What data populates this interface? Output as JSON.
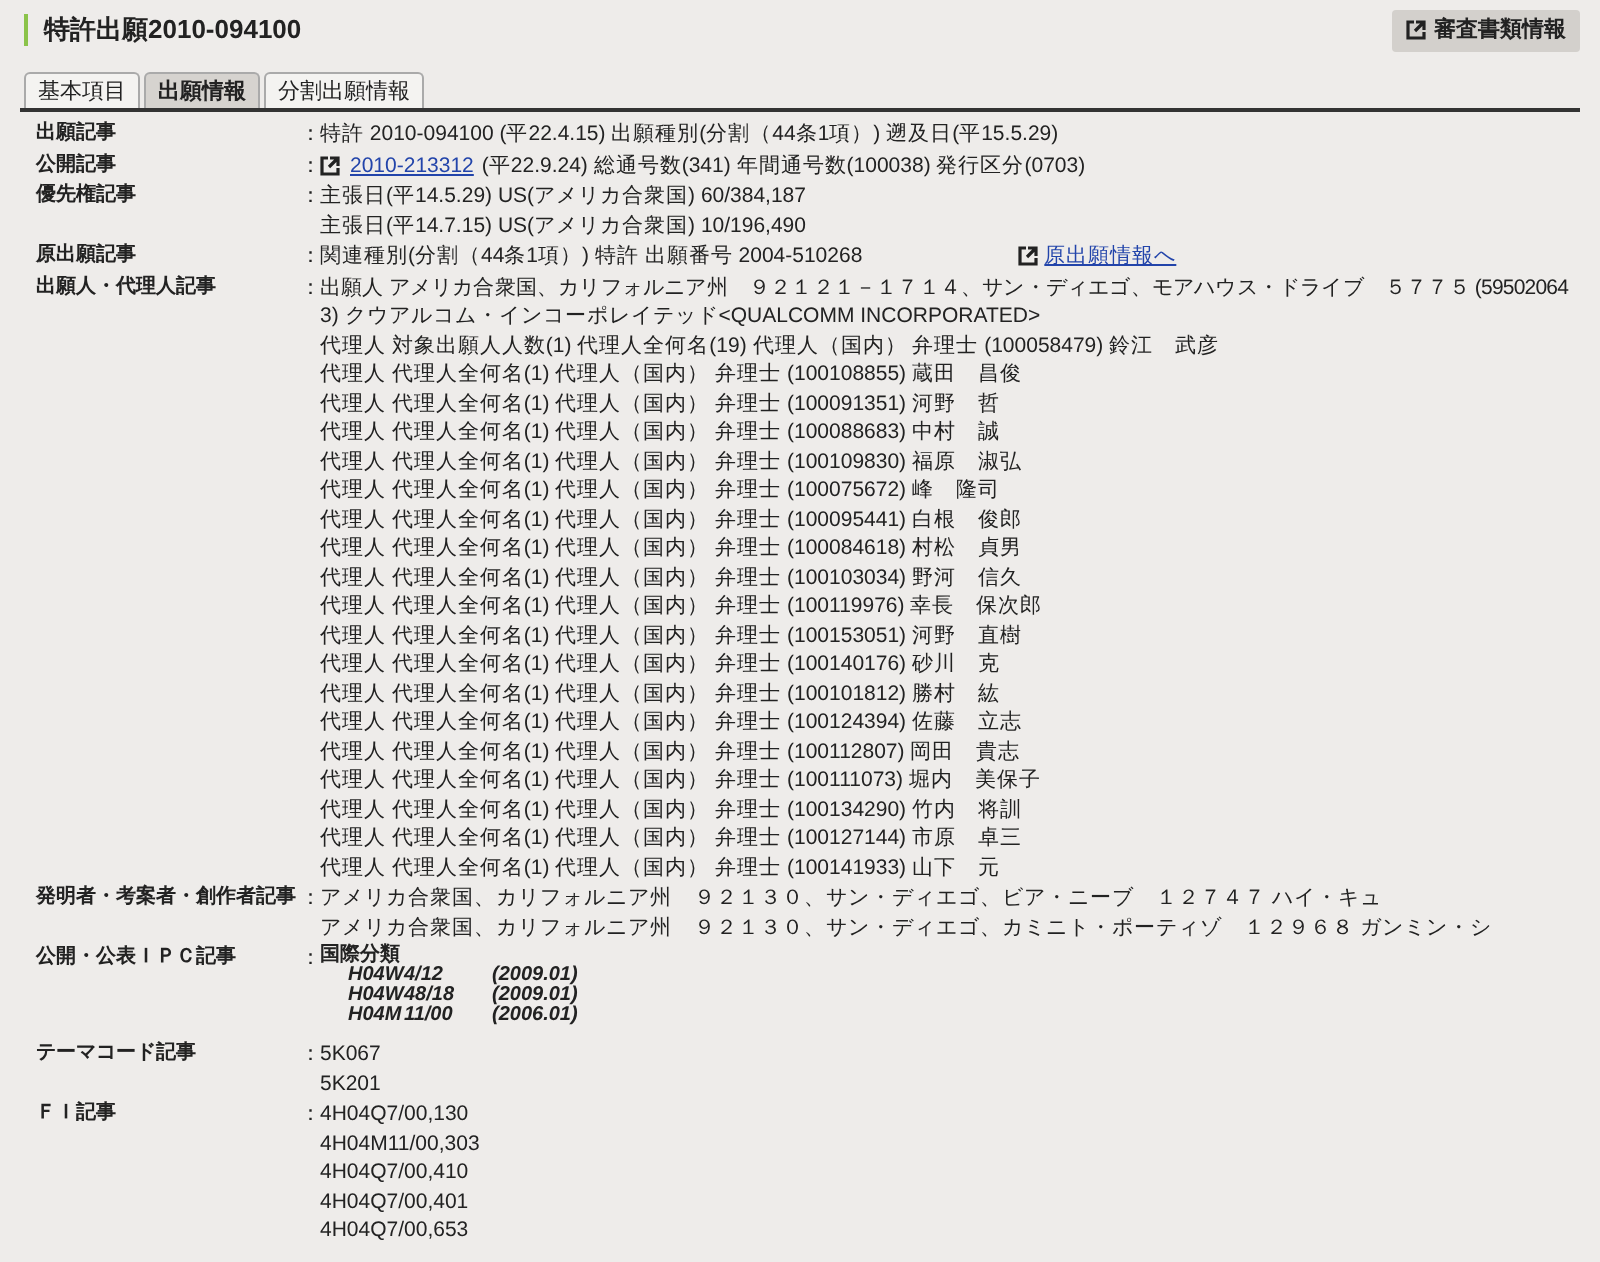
{
  "title": "特許出願2010-094100",
  "docs_button": "審査書類情報",
  "tabs": [
    {
      "label": "基本項目",
      "selected": false
    },
    {
      "label": "出願情報",
      "selected": true
    },
    {
      "label": "分割出願情報",
      "selected": false
    }
  ],
  "sections": [
    {
      "kind": "lines",
      "colon": "：",
      "label": "出願記事",
      "lines": [
        {
          "text": "特許 2010-094100 (平22.4.15) 出願種別(分割（44条1項）) 遡及日(平15.5.29)"
        }
      ]
    },
    {
      "kind": "lines",
      "colon": "：",
      "label": "公開記事",
      "lines": [
        {
          "link": "2010-213312",
          "text": "(平22.9.24) 総通号数(341) 年間通号数(100038) 発行区分(0703)"
        }
      ]
    },
    {
      "kind": "lines",
      "colon": "：",
      "label": "優先権記事",
      "lines": [
        {
          "text": "主張日(平14.5.29) US(アメリカ合衆国) 60/384,187"
        },
        {
          "text": "主張日(平14.7.15) US(アメリカ合衆国) 10/196,490"
        }
      ]
    },
    {
      "kind": "lines",
      "colon": "：",
      "label": "原出願記事",
      "lines": [
        {
          "text": "関連種別(分割（44条1項）) 特許 出願番号 2004-510268",
          "trailing_link": "原出願情報へ"
        }
      ]
    },
    {
      "kind": "lines",
      "colon": "：",
      "label": "出願人・代理人記事",
      "lines": [
        {
          "text": "出願人 アメリカ合衆国、カリフォルニア州　９２１２１－１７１４、サン・ディエゴ、モアハウス・ドライブ　５７７５ (59502064"
        },
        {
          "text": "3) クウアルコム・インコーポレイテッド<QUALCOMM INCORPORATED>"
        },
        {
          "text": "代理人 対象出願人人数(1) 代理人全何名(19) 代理人（国内） 弁理士 (100058479) 鈴江　武彦"
        },
        {
          "text": "代理人 代理人全何名(1) 代理人（国内） 弁理士 (100108855) 蔵田　昌俊"
        },
        {
          "text": "代理人 代理人全何名(1) 代理人（国内） 弁理士 (100091351) 河野　哲"
        },
        {
          "text": "代理人 代理人全何名(1) 代理人（国内） 弁理士 (100088683) 中村　誠"
        },
        {
          "text": "代理人 代理人全何名(1) 代理人（国内） 弁理士 (100109830) 福原　淑弘"
        },
        {
          "text": "代理人 代理人全何名(1) 代理人（国内） 弁理士 (100075672) 峰　隆司"
        },
        {
          "text": "代理人 代理人全何名(1) 代理人（国内） 弁理士 (100095441) 白根　俊郎"
        },
        {
          "text": "代理人 代理人全何名(1) 代理人（国内） 弁理士 (100084618) 村松　貞男"
        },
        {
          "text": "代理人 代理人全何名(1) 代理人（国内） 弁理士 (100103034) 野河　信久"
        },
        {
          "text": "代理人 代理人全何名(1) 代理人（国内） 弁理士 (100119976) 幸長　保次郎"
        },
        {
          "text": "代理人 代理人全何名(1) 代理人（国内） 弁理士 (100153051) 河野　直樹"
        },
        {
          "text": "代理人 代理人全何名(1) 代理人（国内） 弁理士 (100140176) 砂川　克"
        },
        {
          "text": "代理人 代理人全何名(1) 代理人（国内） 弁理士 (100101812) 勝村　紘"
        },
        {
          "text": "代理人 代理人全何名(1) 代理人（国内） 弁理士 (100124394) 佐藤　立志"
        },
        {
          "text": "代理人 代理人全何名(1) 代理人（国内） 弁理士 (100112807) 岡田　貴志"
        },
        {
          "text": "代理人 代理人全何名(1) 代理人（国内） 弁理士 (100111073) 堀内　美保子"
        },
        {
          "text": "代理人 代理人全何名(1) 代理人（国内） 弁理士 (100134290) 竹内　将訓"
        },
        {
          "text": "代理人 代理人全何名(1) 代理人（国内） 弁理士 (100127144) 市原　卓三"
        },
        {
          "text": "代理人 代理人全何名(1) 代理人（国内） 弁理士 (100141933) 山下　元"
        }
      ]
    },
    {
      "kind": "lines",
      "colon": "：",
      "label": "発明者・考案者・創作者記事",
      "lines": [
        {
          "text": "アメリカ合衆国、カリフォルニア州　９２１３０、サン・ディエゴ、ビア・ニーブ　１２７４７ ハイ・キュ"
        },
        {
          "text": "アメリカ合衆国、カリフォルニア州　９２１３０、サン・ディエゴ、カミニト・ポーティゾ　１２９６８ ガンミン・シ"
        }
      ]
    },
    {
      "kind": "ipc",
      "colon": "：",
      "label": "公開・公表ＩＰＣ記事",
      "heading": "国際分類",
      "rows": [
        [
          "H04W",
          "4/12",
          "(2009.01)"
        ],
        [
          "H04W",
          "48/18",
          "(2009.01)"
        ],
        [
          "H04M",
          "11/00",
          "(2006.01)"
        ]
      ]
    },
    {
      "kind": "lines",
      "colon": "：",
      "label": "テーマコード記事",
      "lines": [
        {
          "text": "5K067"
        },
        {
          "text": "5K201"
        }
      ]
    },
    {
      "kind": "lines",
      "colon": "：",
      "label": "ＦＩ記事",
      "lines": [
        {
          "text": "4H04Q7/00,130"
        },
        {
          "text": "4H04M11/00,303"
        },
        {
          "text": "4H04Q7/00,410"
        },
        {
          "text": "4H04Q7/00,401"
        },
        {
          "text": "4H04Q7/00,653"
        }
      ]
    }
  ]
}
